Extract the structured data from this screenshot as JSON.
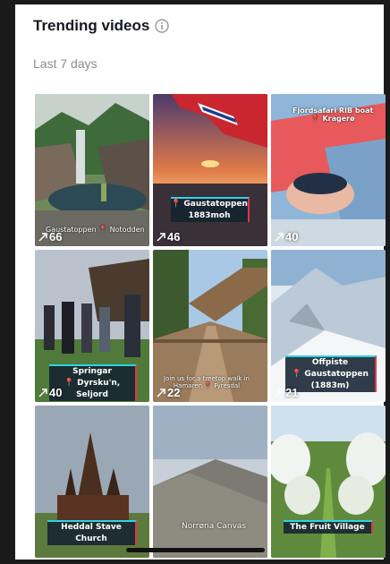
{
  "header": {
    "title": "Trending videos",
    "subtitle": "Last 7 days"
  },
  "tiles": [
    {
      "count": "66",
      "overlay": "Gaustatoppen 📍 Notodden"
    },
    {
      "count": "46",
      "caption_line1": "📍 Gaustatoppen",
      "caption_line2": "1883moh"
    },
    {
      "count": "40",
      "overlay_line1": "Fjordsafari RIB boat",
      "overlay_line2": "📍 Kragerø"
    },
    {
      "count": "40",
      "caption_line1": "Springar",
      "caption_line2": "📍 Dyrsku'n, Seljord"
    },
    {
      "count": "22",
      "overlay_line1": "Join us for a treetop walk in",
      "overlay_line2": "Hamaren 📍 Fyresdal"
    },
    {
      "count": "21",
      "caption_line1": "Offpiste",
      "caption_line2": "📍 Gaustatoppen (1883m)"
    },
    {
      "count": "",
      "caption_line1": "Heddal Stave Church"
    },
    {
      "count": "",
      "overlay": "Norrøna Canvas"
    },
    {
      "count": "",
      "caption_line1": "The Fruit Village"
    }
  ],
  "icons": {
    "info": "info-icon",
    "trend": "trend-arrow-icon"
  }
}
